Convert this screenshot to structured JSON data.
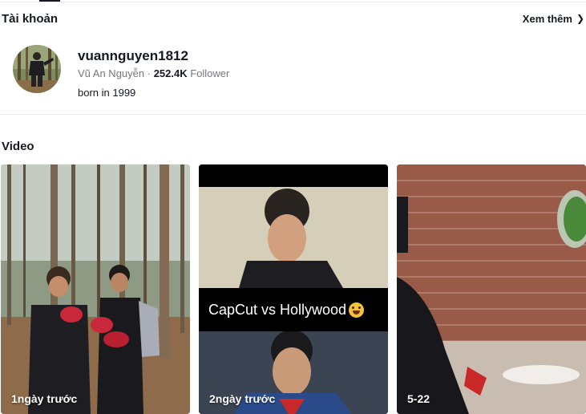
{
  "accounts_section": {
    "title": "Tài khoản",
    "see_more_label": "Xem thêm",
    "see_more_icon": "chevron-right-icon"
  },
  "account": {
    "username": "vuannguyen1812",
    "display_name": "Vũ An Nguyễn",
    "separator": " · ",
    "follower_count": "252.4K",
    "follower_label": " Follower",
    "bio": "born in 1999"
  },
  "video_section": {
    "title": "Video",
    "items": [
      {
        "label": "1ngày trước"
      },
      {
        "label": "2ngày trước",
        "caption": "CapCut vs Hollywood",
        "caption_icon": "grinning-sweat-emoji-icon"
      },
      {
        "label": "5-22"
      }
    ]
  },
  "colors": {
    "text_primary": "#161823",
    "text_secondary": "#8a8b91",
    "divider": "#ececec"
  }
}
